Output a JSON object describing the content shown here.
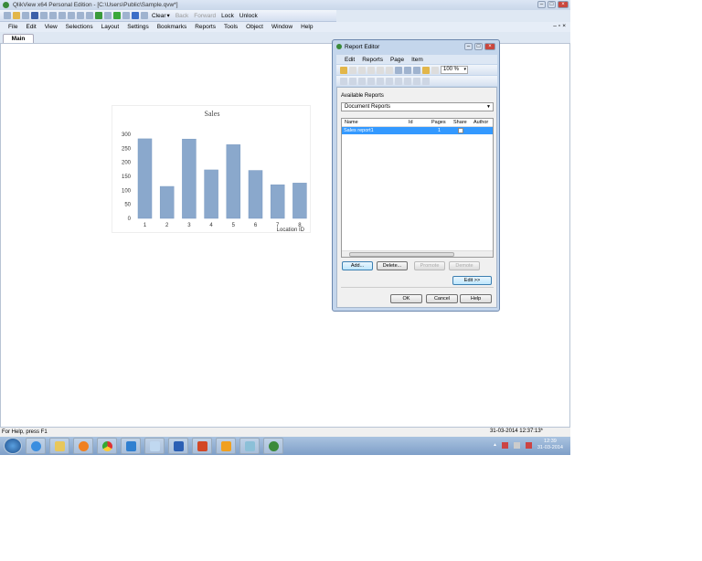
{
  "window": {
    "title": "QlikView x64 Personal Edition - [C:\\Users\\Public\\Sample.qvw*]"
  },
  "toolbar": {
    "clear": "Clear",
    "back": "Back",
    "forward": "Forward",
    "lock": "Lock",
    "unlock": "Unlock"
  },
  "menu": [
    "File",
    "Edit",
    "View",
    "Selections",
    "Layout",
    "Settings",
    "Bookmarks",
    "Reports",
    "Tools",
    "Object",
    "Window",
    "Help"
  ],
  "tabs": [
    {
      "label": "Main",
      "active": true
    }
  ],
  "chart_data": {
    "type": "bar",
    "title": "Sales",
    "xlabel": "Location ID",
    "ylabel": "",
    "categories": [
      "1",
      "2",
      "3",
      "4",
      "5",
      "6",
      "7",
      "8"
    ],
    "values": [
      284,
      114,
      283,
      173,
      263,
      171,
      120,
      126
    ],
    "yticks": [
      0,
      50,
      100,
      150,
      200,
      250,
      300
    ],
    "ylim": [
      0,
      300
    ],
    "grid": false,
    "color": "#8aa8cc"
  },
  "report_editor": {
    "title": "Report Editor",
    "menu": [
      "Edit",
      "Reports",
      "Page",
      "Item"
    ],
    "zoom": "100 %",
    "available_reports_label": "Available Reports",
    "reports_scope": "Document Reports",
    "columns": [
      "Name",
      "Id",
      "Pages",
      "Share",
      "Author"
    ],
    "rows": [
      {
        "name": "Sales report1",
        "id": "",
        "pages": "1",
        "share": false,
        "author": ""
      }
    ],
    "buttons": {
      "add": "Add...",
      "delete": "Delete...",
      "promote": "Promote",
      "demote": "Demote",
      "edit": "Edit >>",
      "ok": "OK",
      "cancel": "Cancel",
      "help": "Help"
    }
  },
  "status": {
    "help": "For Help, press F1",
    "timestamp": "31-03-2014 12:37:13*"
  },
  "taskbar": {
    "time": "12:39",
    "date": "31-03-2014"
  }
}
